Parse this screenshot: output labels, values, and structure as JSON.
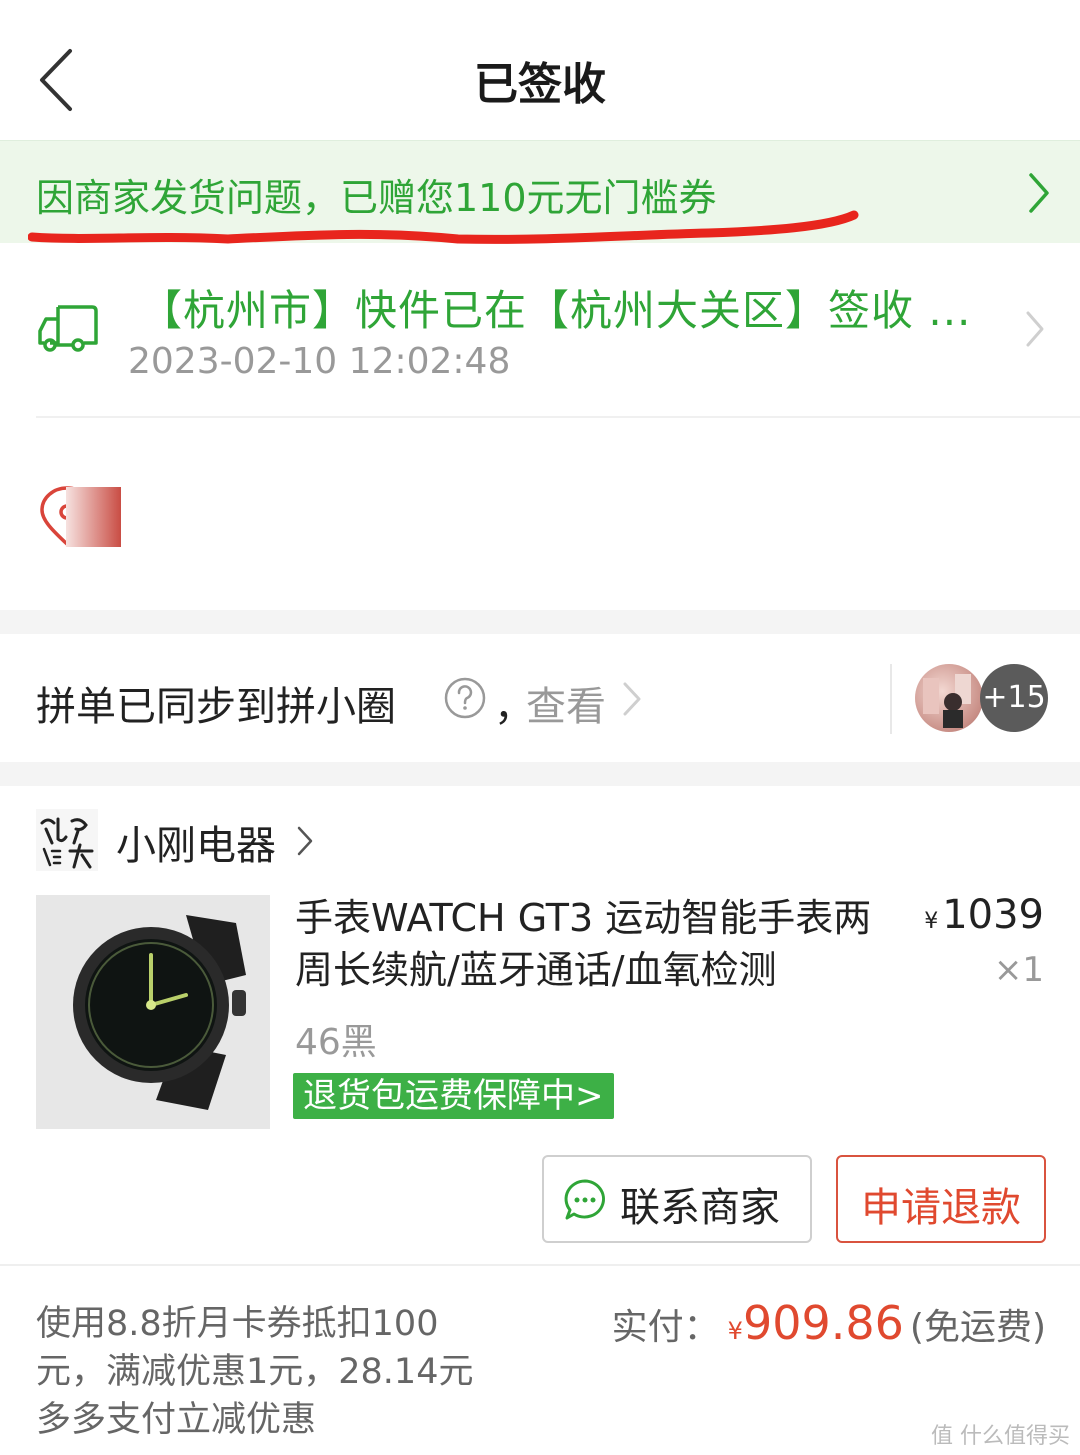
{
  "header": {
    "title": "已签收"
  },
  "coupon_banner": {
    "text": "因商家发货问题，已赠您110元无门槛券"
  },
  "logistics": {
    "status": "【杭州市】快件已在【杭州大关区】签收 ...",
    "time": "2023-02-10 12:02:48"
  },
  "share": {
    "text": "拼单已同步到拼小圈",
    "comma": "，",
    "view_label": "查看",
    "extra_count": "+15"
  },
  "store": {
    "name": "小刚电器"
  },
  "product": {
    "title": "手表WATCH GT3 运动智能手表两周长续航/蓝牙通话/血氧检测",
    "currency": "¥",
    "price": "1039",
    "quantity": "×1",
    "spec": "46黑",
    "guarantee": "退货包运费保障中>"
  },
  "actions": {
    "contact_label": "联系商家",
    "refund_label": "申请退款"
  },
  "payment": {
    "discount_note": "使用8.8折月卡券抵扣100元，满减优惠1元，28.14元多多支付立减优惠",
    "label": "实付：",
    "currency": "¥",
    "amount": "909.86",
    "note": "(免运费)"
  },
  "watermark": "值 什么值得买",
  "colors": {
    "accent_green": "#2fa537",
    "accent_red": "#e0492f",
    "banner_bg": "#edf7ea"
  }
}
